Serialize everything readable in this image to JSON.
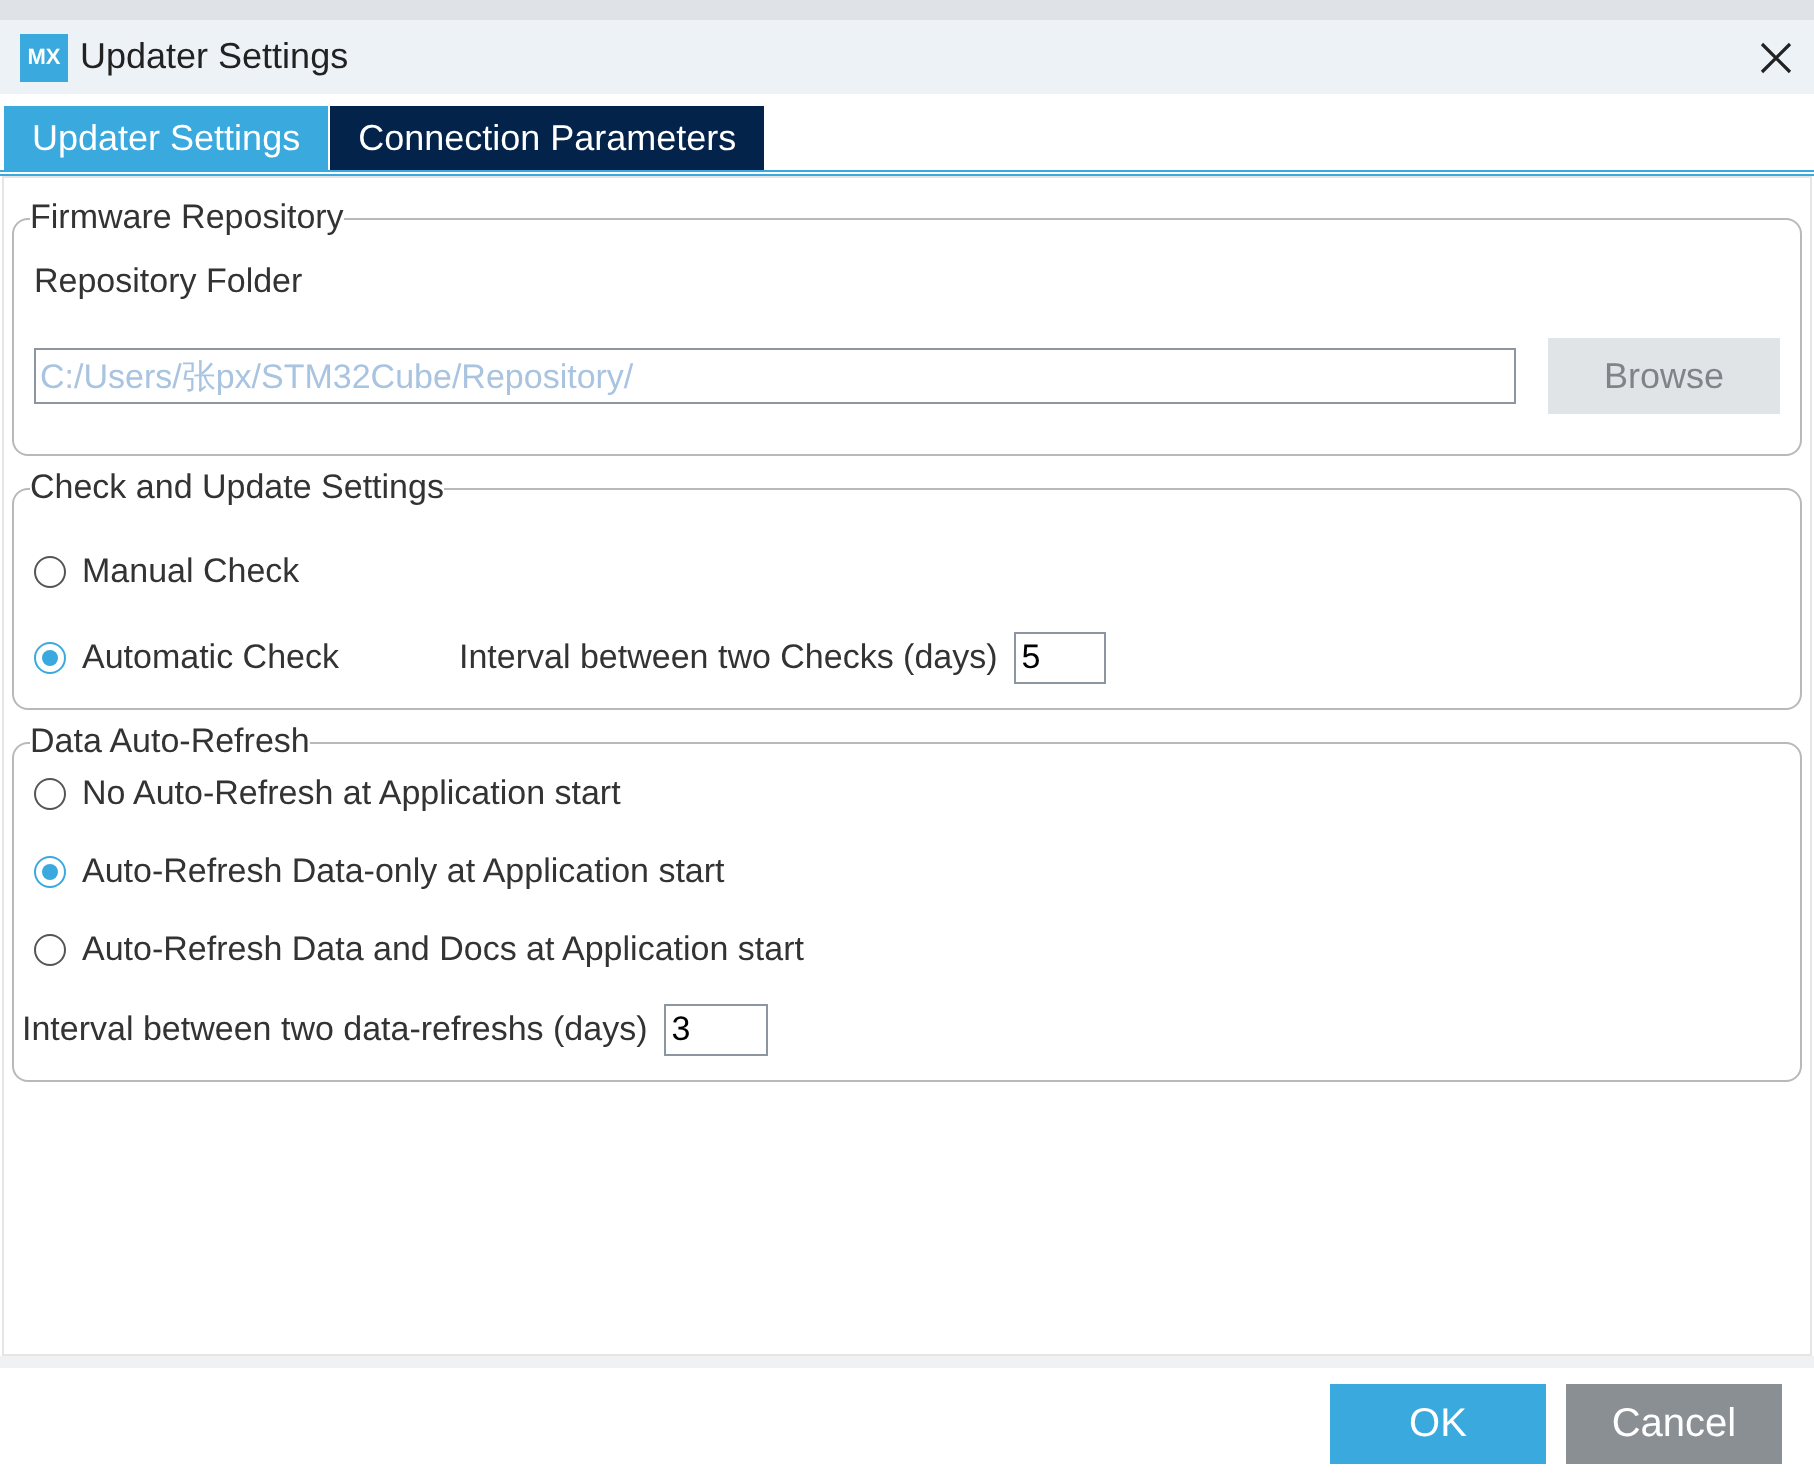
{
  "window": {
    "title": "Updater Settings",
    "logo": "MX"
  },
  "tabs": [
    {
      "label": "Updater Settings",
      "selected": true
    },
    {
      "label": "Connection Parameters",
      "selected": false
    }
  ],
  "firmware_repository": {
    "title": "Firmware Repository",
    "folder_label": "Repository Folder",
    "folder_value": "C:/Users/张px/STM32Cube/Repository/",
    "disabled": true,
    "browse_button": "Browse"
  },
  "check_settings": {
    "title": "Check and Update Settings",
    "options": [
      {
        "label": "Manual Check",
        "selected": false
      },
      {
        "label": "Automatic Check",
        "selected": true
      }
    ],
    "interval_label": "Interval between two Checks (days)",
    "interval_value": "5"
  },
  "data_refresh": {
    "title": "Data Auto-Refresh",
    "options": [
      {
        "label": "No Auto-Refresh at Application start",
        "selected": false
      },
      {
        "label": "Auto-Refresh Data-only at Application start",
        "selected": true
      },
      {
        "label": "Auto-Refresh Data and Docs at Application start",
        "selected": false
      }
    ],
    "interval_label": "Interval between two data-refreshs (days)",
    "interval_value": "3"
  },
  "buttons": [
    {
      "label": "OK",
      "kind": "primary"
    },
    {
      "label": "Cancel",
      "kind": "secondary"
    }
  ]
}
